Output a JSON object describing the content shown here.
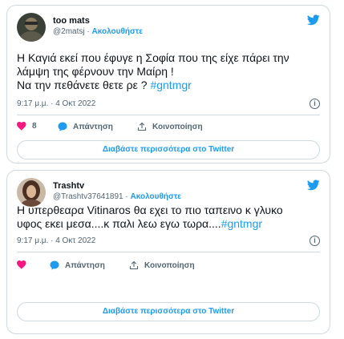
{
  "tweets": [
    {
      "display_name": "too mats",
      "handle": "@2matsj",
      "follow_label": "Ακολουθήστε",
      "text_lines": [
        "Η Καγιά εκεί που έφυγε η Σοφία που της είχε πάρει την",
        "λάμψη της φέρνουν την Μαίρη !"
      ],
      "text_last": "Να την πεθάνετε θετε ρε ? ",
      "hashtag": "#gntmgr",
      "timestamp": "9:17 μ.μ. · 4 Οκτ 2022",
      "like_count": "8",
      "reply_label": "Απάντηση",
      "share_label": "Κοινοποίηση",
      "read_more_label": "Διαβάστε περισσότερα στο Twitter",
      "like_color": "#f91880"
    },
    {
      "display_name": "Trashtv",
      "handle": "@Trashtv37641891",
      "follow_label": "Ακολουθήστε",
      "text_lines": [
        "Η υπερθεαρα Vitinaros θα εχει το πιο ταπεινο κ γλυκο"
      ],
      "text_last": "υφος εκει μεσα....κ παλι λεω εγω τωρα....",
      "hashtag": "#gntmgr",
      "timestamp": "9:17 μ.μ. · 4 Οκτ 2022",
      "like_count": "",
      "reply_label": "Απάντηση",
      "share_label": "Κοινοποίηση",
      "read_more_label": "Διαβάστε περισσότερα στο Twitter",
      "like_color": "#f91880"
    }
  ],
  "colors": {
    "accent": "#1d9bf0",
    "border": "#cfd9de",
    "muted": "#536471"
  },
  "icons": [
    "twitter-bird-icon",
    "info-icon",
    "heart-icon",
    "reply-icon",
    "share-icon"
  ]
}
